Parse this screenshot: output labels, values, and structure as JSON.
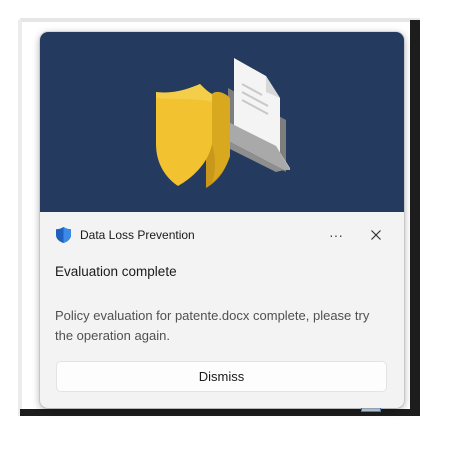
{
  "notification": {
    "app_name": "Data Loss Prevention",
    "app_icon": "shield-icon",
    "more_label": "···",
    "close_icon": "close-icon",
    "title": "Evaluation complete",
    "body": "Policy evaluation for patente.docx complete, please try the operation again.",
    "dismiss_label": "Dismiss"
  },
  "hero": {
    "background": "#243a5e",
    "shield_color": "#f2c230",
    "folder_color": "#b9b9b9"
  },
  "colors": {
    "accent": "#0f6cbd"
  }
}
